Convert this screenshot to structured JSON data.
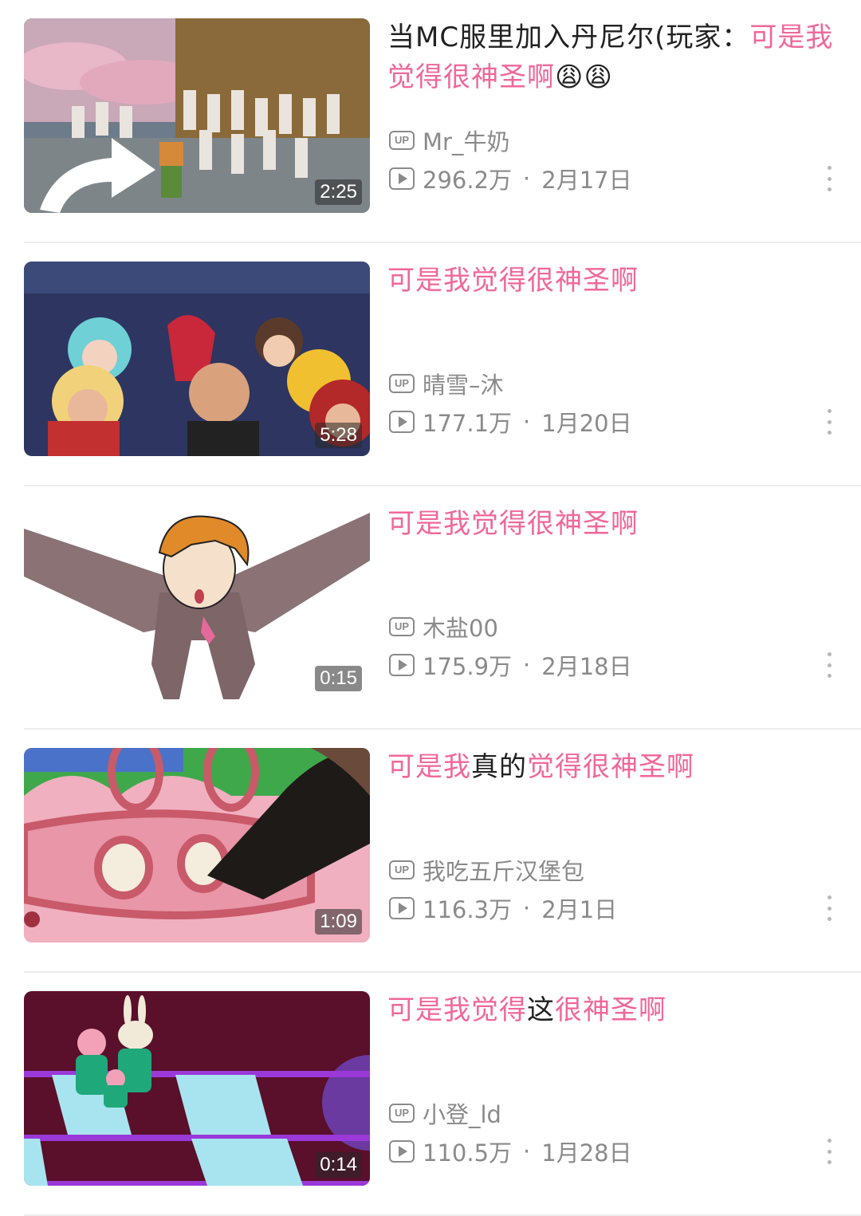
{
  "colors": {
    "highlight": "#f0679a",
    "text": "#212121",
    "meta": "#8a8a8a"
  },
  "videos": [
    {
      "thumbnail": "minecraft-crowd",
      "duration": "2:25",
      "title_parts": [
        {
          "text": "当MC服里加入丹尼尔(玩家：",
          "highlight": false
        },
        {
          "text": "可是我觉得很神圣啊",
          "highlight": true
        },
        {
          "text": "😩😩",
          "highlight": false
        }
      ],
      "up_icon": "UP",
      "author": "Mr_牛奶",
      "views": "296.2万",
      "date": "2月17日"
    },
    {
      "thumbnail": "game-characters",
      "duration": "5:28",
      "title_parts": [
        {
          "text": "可是我觉得很神圣啊",
          "highlight": true
        }
      ],
      "up_icon": "UP",
      "author": "晴雪–沐",
      "views": "177.1万",
      "date": "1月20日"
    },
    {
      "thumbnail": "anime-man-arms-wide",
      "duration": "0:15",
      "title_parts": [
        {
          "text": "可是我觉得很神圣啊",
          "highlight": true
        }
      ],
      "up_icon": "UP",
      "author": "木盐00",
      "views": "175.9万",
      "date": "2月18日"
    },
    {
      "thumbnail": "pink-pig-drawing",
      "duration": "1:09",
      "title_parts": [
        {
          "text": "可是我",
          "highlight": true
        },
        {
          "text": "真的",
          "highlight": false
        },
        {
          "text": "觉得很神圣啊",
          "highlight": true
        }
      ],
      "up_icon": "UP",
      "author": "我吃五斤汉堡包",
      "views": "116.3万",
      "date": "2月1日"
    },
    {
      "thumbnail": "peppa-pig-glass-bridge",
      "duration": "0:14",
      "title_parts": [
        {
          "text": "可是我觉得",
          "highlight": true
        },
        {
          "text": "这",
          "highlight": false
        },
        {
          "text": "很神圣啊",
          "highlight": true
        }
      ],
      "up_icon": "UP",
      "author": "小登_ld",
      "views": "110.5万",
      "date": "1月28日"
    }
  ]
}
